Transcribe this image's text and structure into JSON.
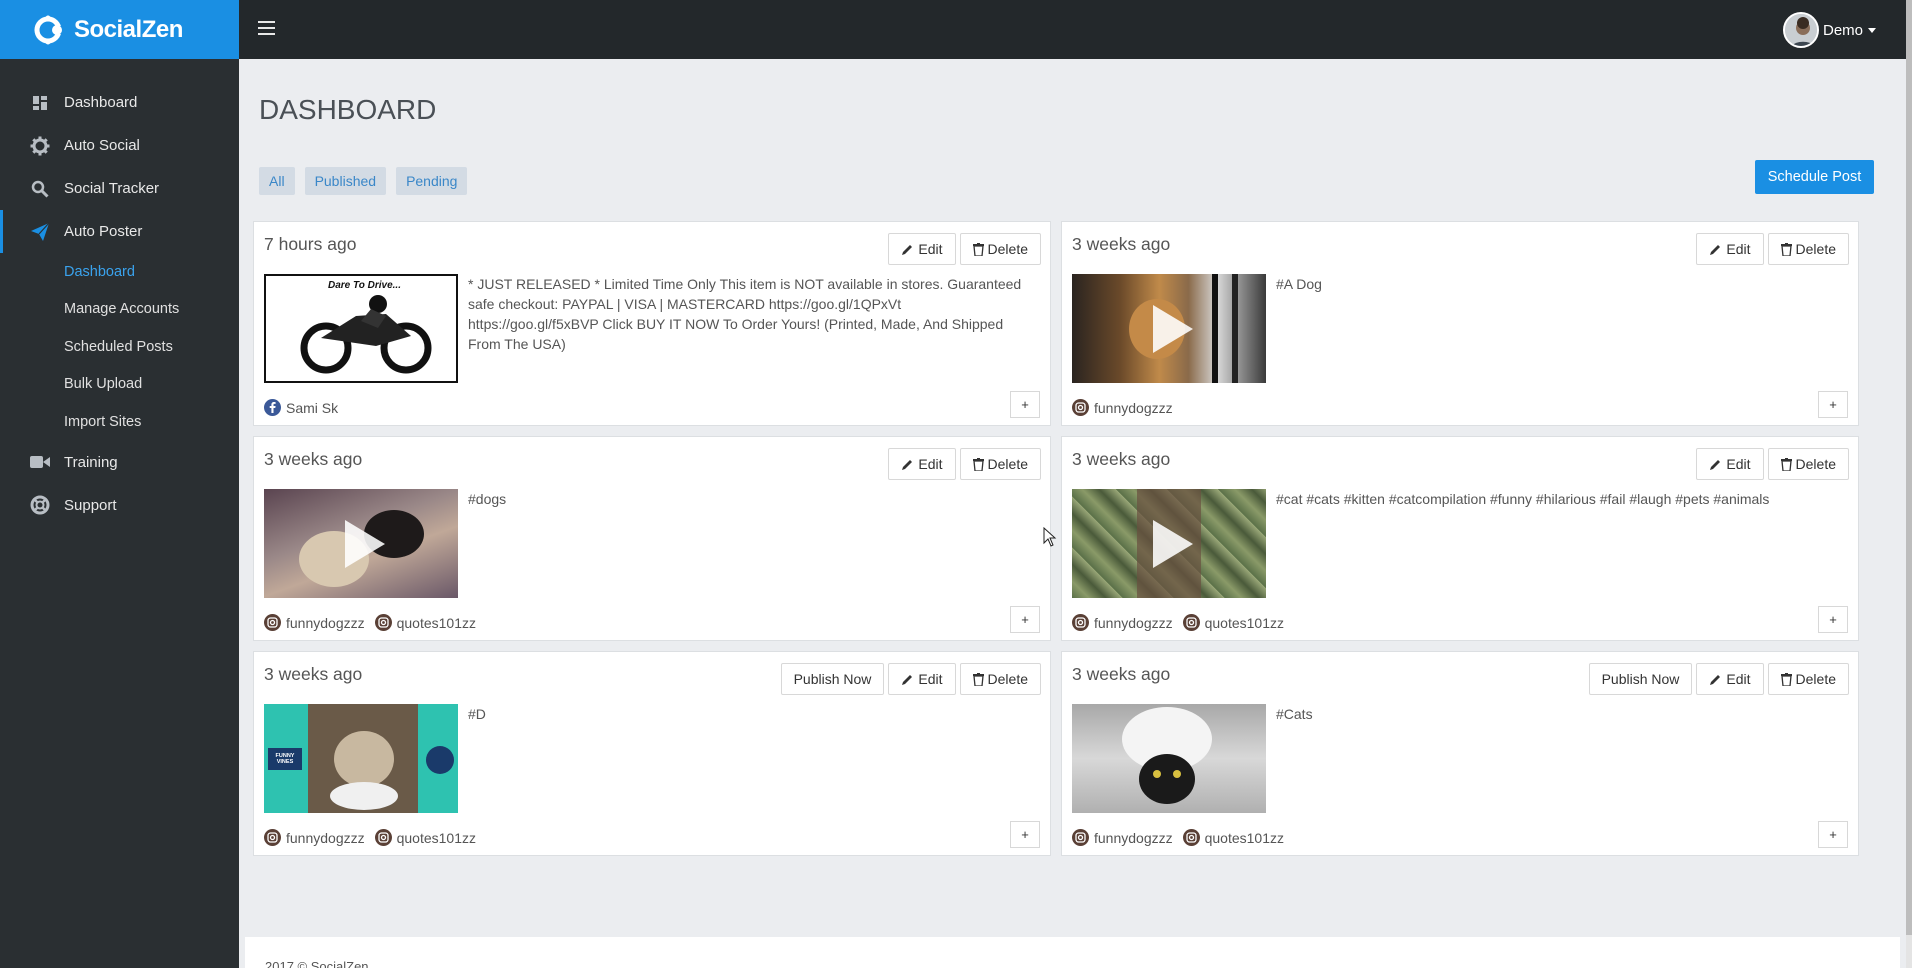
{
  "brand": {
    "name": "SocialZen"
  },
  "sidebar": {
    "items": [
      {
        "label": "Dashboard",
        "icon": "dashboard-icon"
      },
      {
        "label": "Auto Social",
        "icon": "gear-icon"
      },
      {
        "label": "Social Tracker",
        "icon": "search-icon"
      },
      {
        "label": "Auto Poster",
        "icon": "paper-plane-icon"
      },
      {
        "label": "Training",
        "icon": "video-camera-icon"
      },
      {
        "label": "Support",
        "icon": "lifebuoy-icon"
      }
    ],
    "sub_items": [
      {
        "label": "Dashboard"
      },
      {
        "label": "Manage Accounts"
      },
      {
        "label": "Scheduled Posts"
      },
      {
        "label": "Bulk Upload"
      },
      {
        "label": "Import Sites"
      }
    ]
  },
  "topbar": {
    "user_name": "Demo"
  },
  "page": {
    "title": "DASHBOARD",
    "filters": [
      "All",
      "Published",
      "Pending"
    ],
    "schedule_label": "Schedule Post"
  },
  "labels": {
    "edit": "Edit",
    "delete": "Delete",
    "publish": "Publish Now",
    "plus": "+"
  },
  "posts": [
    {
      "time": "7 hours ago",
      "text": "* JUST RELEASED * Limited Time Only This item is NOT available in stores. Guaranteed safe checkout: PAYPAL | VISA | MASTERCARD https://goo.gl/1QPxVt https://goo.gl/f5xBVP Click BUY IT NOW To Order Yours! (Printed, Made, And Shipped From The USA)",
      "thumb_caption": "Dare To Drive...",
      "accounts": [
        "Sami Sk"
      ]
    },
    {
      "time": "3 weeks ago",
      "text": "#A Dog",
      "accounts": [
        "funnydogzzz"
      ]
    },
    {
      "time": "3 weeks ago",
      "text": "#dogs",
      "accounts": [
        "funnydogzzz",
        "quotes101zz"
      ]
    },
    {
      "time": "3 weeks ago",
      "text": "#cat #cats #kitten #catcompilation #funny #hilarious #fail #laugh #pets #animals",
      "accounts": [
        "funnydogzzz",
        "quotes101zz"
      ]
    },
    {
      "time": "3 weeks ago",
      "text": "#D",
      "thumb_caption": "FUNNY VINES",
      "accounts": [
        "funnydogzzz",
        "quotes101zz"
      ]
    },
    {
      "time": "3 weeks ago",
      "text": "#Cats",
      "accounts": [
        "funnydogzzz",
        "quotes101zz"
      ]
    }
  ],
  "footer": {
    "text": "2017 © SocialZen"
  },
  "colors": {
    "accent": "#1a8fe3",
    "sidebar": "#2a2f32",
    "topbar": "#23282b",
    "facebook": "#3b5998"
  }
}
